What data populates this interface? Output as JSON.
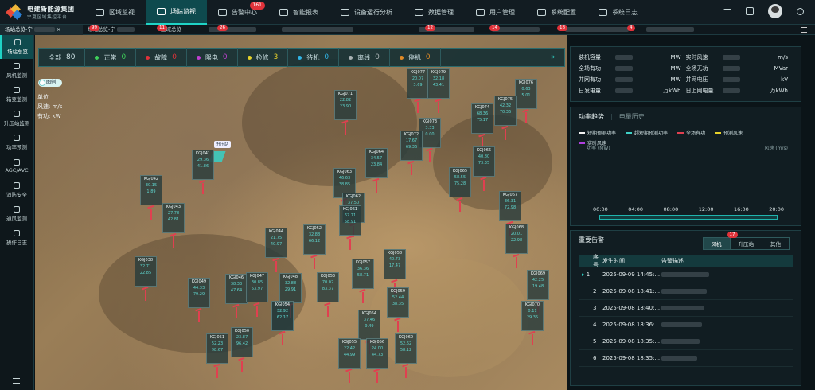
{
  "app": {
    "brand": "电建新能源集团",
    "brand_sub": "宁夏区域集控平台"
  },
  "nav": [
    {
      "label": "区域监视",
      "icon": "monitor-icon"
    },
    {
      "label": "场站监视",
      "icon": "screen-icon",
      "active": true
    },
    {
      "label": "告警中心",
      "icon": "alarm-icon",
      "badge": "161"
    },
    {
      "label": "智能报表",
      "icon": "chart-icon"
    },
    {
      "label": "设备运行分析",
      "icon": "gear-analysis-icon"
    },
    {
      "label": "数据管理",
      "icon": "data-icon"
    },
    {
      "label": "用户管理",
      "icon": "user-icon"
    },
    {
      "label": "系统配置",
      "icon": "settings-icon"
    },
    {
      "label": "系统日志",
      "icon": "log-icon"
    }
  ],
  "tabs": [
    {
      "label": "场站总览-宁"
    },
    {
      "label": "场站总览-宁"
    },
    {
      "label": "区域总览"
    }
  ],
  "tab_badges": [
    "99",
    "11",
    "26",
    "12",
    "14",
    "18",
    "4"
  ],
  "sidebar": [
    {
      "label": "场站总览",
      "active": true
    },
    {
      "label": "风机监测"
    },
    {
      "label": "箱变监测"
    },
    {
      "label": "升压站监测"
    },
    {
      "label": "功率预测"
    },
    {
      "label": "AGC/AVC"
    },
    {
      "label": "消防安全"
    },
    {
      "label": "通风监测"
    },
    {
      "label": "操作日志"
    }
  ],
  "status": {
    "all_label": "全部",
    "all": "80",
    "items": [
      {
        "label": "正常",
        "value": "0",
        "color": "#3fd15a"
      },
      {
        "label": "故障",
        "value": "0",
        "color": "#e0323a"
      },
      {
        "label": "限电",
        "value": "0",
        "color": "#c13fd1"
      },
      {
        "label": "检修",
        "value": "3",
        "color": "#e6d12a"
      },
      {
        "label": "待机",
        "value": "0",
        "color": "#30b4e6"
      },
      {
        "label": "离线",
        "value": "0",
        "color": "#a9b2b4"
      },
      {
        "label": "停机",
        "value": "0",
        "color": "#e08a26"
      }
    ]
  },
  "map": {
    "toggle": "图例",
    "unit_title": "单位",
    "unit_wind": "风速: m/s",
    "unit_power": "有功: kW",
    "station_label": "升压站"
  },
  "kv": [
    [
      {
        "k": "装机容量",
        "u": "MW"
      },
      {
        "k": "实时风速",
        "u": "m/s"
      }
    ],
    [
      {
        "k": "全场有功",
        "u": "MW"
      },
      {
        "k": "全场无功",
        "u": "MVar"
      }
    ],
    [
      {
        "k": "并网有功",
        "u": "MW"
      },
      {
        "k": "并网电压",
        "u": "kV"
      }
    ],
    [
      {
        "k": "日发电量",
        "u": "万kWh"
      },
      {
        "k": "日上网电量",
        "u": "万kWh"
      }
    ]
  ],
  "power": {
    "title": "功率趋势",
    "sub": "电量历史",
    "legend": [
      "短期预测功率",
      "超短期预测功率",
      "全场有功",
      "预测风速",
      "实时风速"
    ],
    "yl": "功率 (MW)",
    "yr": "风速 (m/s)",
    "ticks": [
      "00:00",
      "04:00",
      "08:00",
      "12:00",
      "16:00",
      "20:00"
    ]
  },
  "alarm": {
    "title": "重要告警",
    "tabs": [
      "风机",
      "升压站",
      "其他"
    ],
    "badge": "17",
    "headers": [
      "序号",
      "发生时间",
      "告警描述"
    ],
    "rows": [
      {
        "n": "1",
        "t": "2025-09-09 14:45:..."
      },
      {
        "n": "2",
        "t": "2025-09-08 18:41:..."
      },
      {
        "n": "3",
        "t": "2025-09-08 18:40:..."
      },
      {
        "n": "4",
        "t": "2025-09-08 18:36:..."
      },
      {
        "n": "5",
        "t": "2025-09-08 18:35:..."
      },
      {
        "n": "6",
        "t": "2025-09-08 18:35:..."
      }
    ]
  },
  "turbines": [
    {
      "id": "KGJ071",
      "a": "22.82",
      "b": "23.90"
    },
    {
      "id": "KGJ077",
      "a": "20.07",
      "b": "3.69"
    },
    {
      "id": "KGJ079",
      "a": "32.18",
      "b": "43.41"
    },
    {
      "id": "KGJ076",
      "a": "0.63",
      "b": "5.01"
    },
    {
      "id": "KGJ075",
      "a": "42.32",
      "b": "70.36"
    },
    {
      "id": "KGJ074",
      "a": "68.36",
      "b": "75.17"
    },
    {
      "id": "KGJ073",
      "a": "3.33",
      "b": "0.00"
    },
    {
      "id": "KGJ072",
      "a": "17.67",
      "b": "69.36"
    },
    {
      "id": "KGJ041",
      "a": "29.36",
      "b": "41.86"
    },
    {
      "id": "KGJ064",
      "a": "34.57",
      "b": "23.84"
    },
    {
      "id": "KGJ066",
      "a": "40.80",
      "b": "73.35"
    },
    {
      "id": "KGJ063",
      "a": "46.63",
      "b": "38.85"
    },
    {
      "id": "KGJ065",
      "a": "58.55",
      "b": "75.28"
    },
    {
      "id": "KGJ042",
      "a": "30.15",
      "b": "1.89"
    },
    {
      "id": "KGJ067",
      "a": "36.31",
      "b": "72.98"
    },
    {
      "id": "KGJ062",
      "a": "37.50",
      "b": "33.90"
    },
    {
      "id": "KGJ043",
      "a": "27.78",
      "b": "42.81"
    },
    {
      "id": "KGJ061",
      "a": "67.71",
      "b": "58.91"
    },
    {
      "id": "KGJ068",
      "a": "20.01",
      "b": "22.98"
    },
    {
      "id": "KGJ044",
      "a": "21.75",
      "b": "40.97"
    },
    {
      "id": "KGJ052",
      "a": "32.88",
      "b": "66.12"
    },
    {
      "id": "KGJ058",
      "a": "40.73",
      "b": "17.47"
    },
    {
      "id": "KGJ038",
      "a": "32.71",
      "b": "22.85"
    },
    {
      "id": "KGJ057",
      "a": "36.36",
      "b": "58.71"
    },
    {
      "id": "KGJ069",
      "a": "42.25",
      "b": "19.48"
    },
    {
      "id": "KGJ045",
      "a": "40.02",
      "b": "42.96"
    },
    {
      "id": "KGJ046",
      "a": "38.33",
      "b": "47.64"
    },
    {
      "id": "KGJ047",
      "a": "30.85",
      "b": "53.97"
    },
    {
      "id": "KGJ048",
      "a": "32.88",
      "b": "29.91"
    },
    {
      "id": "KGJ053",
      "a": "70.02",
      "b": "83.37"
    },
    {
      "id": "KGJ049",
      "a": "44.33",
      "b": "79.29"
    },
    {
      "id": "KGJ059",
      "a": "52.44",
      "b": "38.35"
    },
    {
      "id": "KGJ070",
      "a": "0.11",
      "b": "29.35"
    },
    {
      "id": "KGJ054",
      "a": "32.92",
      "b": "62.17"
    },
    {
      "id": "KGJ054",
      "a": "37.46",
      "b": "9.49"
    },
    {
      "id": "KGJ051",
      "a": "52.23",
      "b": "98.67"
    },
    {
      "id": "KGJ050",
      "a": "23.87",
      "b": "96.42"
    },
    {
      "id": "KGJ055",
      "a": "22.42",
      "b": "44.99"
    },
    {
      "id": "KGJ056",
      "a": "24.00",
      "b": "44.73"
    },
    {
      "id": "KGJ060",
      "a": "52.62",
      "b": "58.12"
    }
  ]
}
